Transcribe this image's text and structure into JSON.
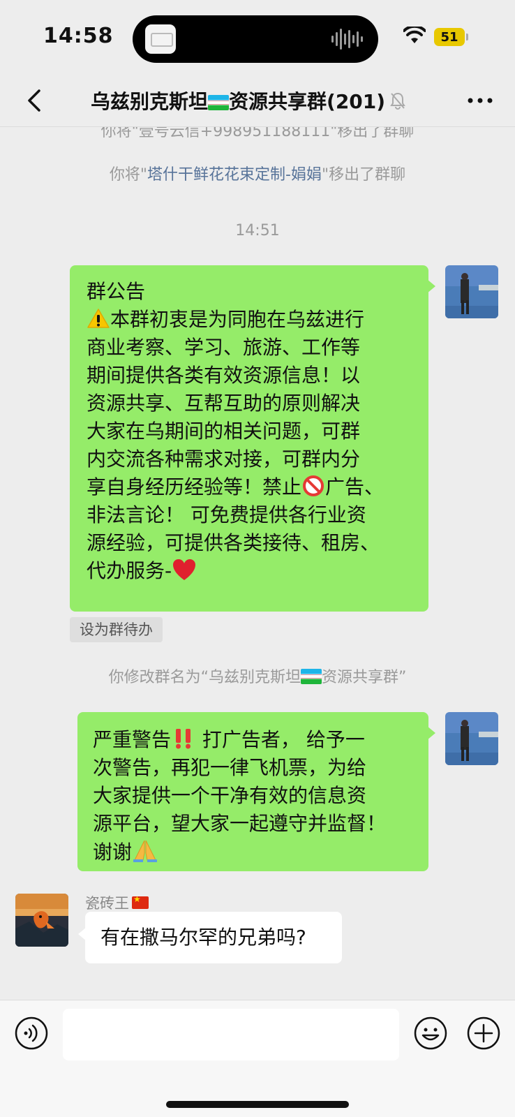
{
  "status_bar": {
    "time": "14:58",
    "battery": "51",
    "icons": [
      "wifi-icon",
      "battery-icon"
    ]
  },
  "nav": {
    "title_prefix": "乌兹别克斯坦",
    "title_suffix": "资源共享群(201)",
    "icons": [
      "back-icon",
      "mute-icon",
      "more-icon"
    ]
  },
  "chat": {
    "partial_notice": "你将\"壹号云信+998951188111\"移出了群聊",
    "remove_notice": {
      "prefix": "你将\"",
      "name": "塔什干鲜花花束定制-娟娟",
      "suffix": "\"移出了群聊"
    },
    "timestamp": "14:51",
    "announcement": {
      "title": "群公告",
      "line1": "本群初衷是为同胞在乌兹进行",
      "lines": [
        "商业考察、学习、旅游、工作等",
        "期间提供各类有效资源信息！以",
        "资源共享、互帮互助的原则解决",
        "大家在乌期间的相关问题，可群",
        "内交流各种需求对接，可群内分"
      ],
      "line7a": "享自身经历经验等！禁止",
      "line7b": "广告、",
      "line8": "非法言论！ 可免费提供各行业资",
      "line9": "源经验，可提供各类接待、租房、",
      "line10": "代办服务-"
    },
    "todo_chip": "设为群待办",
    "rename_notice": {
      "prefix": "你修改群名为“乌兹别克斯坦",
      "suffix": "资源共享群”"
    },
    "warning": {
      "line1a": "严重警告",
      "line1b": " 打广告者， 给予一",
      "line2": "次警告，再犯一律飞机票，为给",
      "line3": "大家提供一个干净有效的信息资",
      "line4": "源平台，望大家一起遵守并监督！",
      "line5": "谢谢"
    },
    "other_message": {
      "sender": "瓷砖王",
      "text": "有在撒马尔罕的兄弟吗?"
    }
  },
  "input_bar": {
    "value": "",
    "icons": [
      "voice-icon",
      "emoji-icon",
      "plus-icon"
    ]
  },
  "colors": {
    "background": "#ededed",
    "my_bubble": "#95ec69",
    "link": "#577399",
    "battery": "#e8c800"
  }
}
